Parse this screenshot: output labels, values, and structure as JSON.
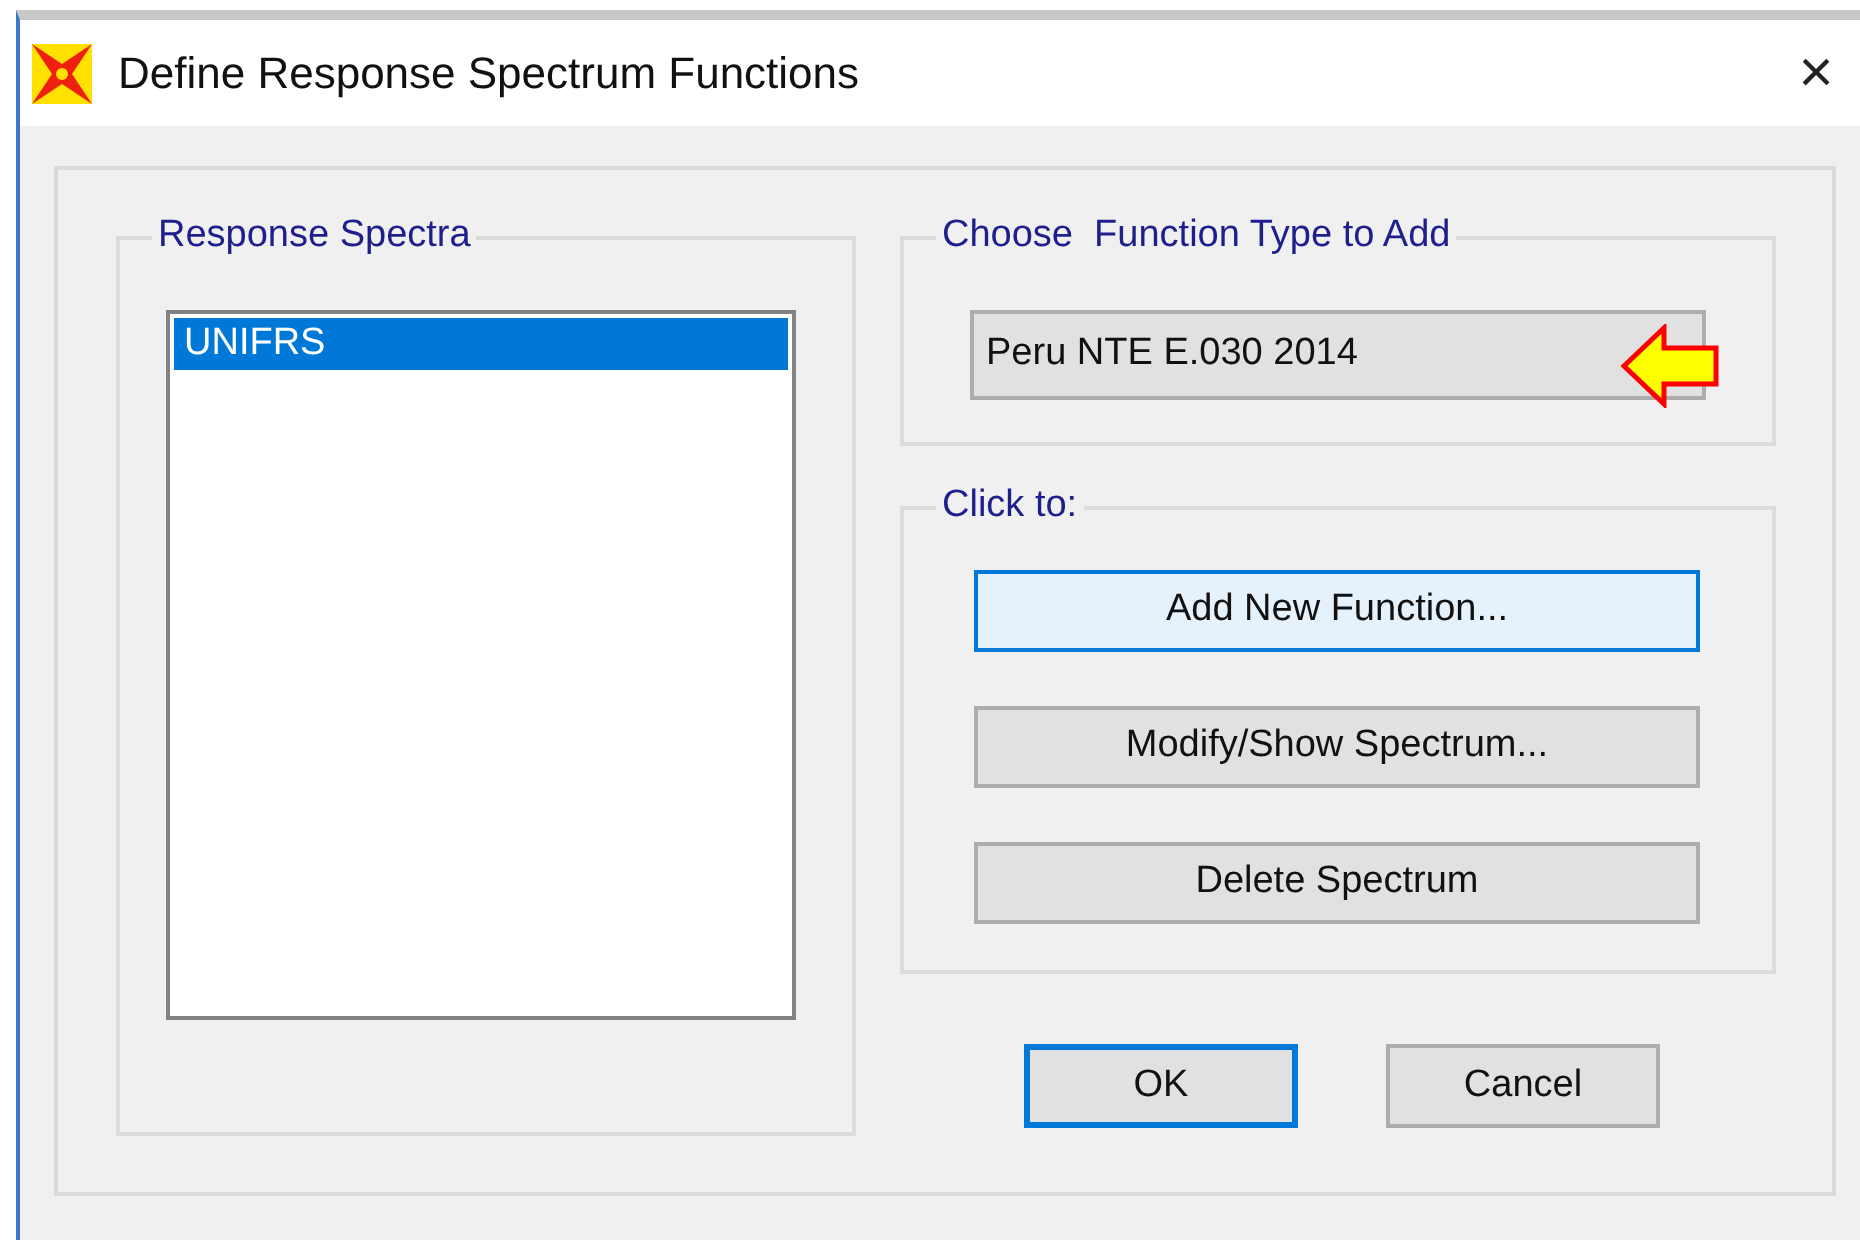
{
  "window": {
    "title": "Define Response Spectrum Functions",
    "close": "×"
  },
  "response_spectra": {
    "label": "Response Spectra",
    "items": [
      {
        "name": "UNIFRS",
        "selected": true
      }
    ]
  },
  "function_type": {
    "label": "Choose  Function Type to Add",
    "value": "Peru NTE E.030 2014"
  },
  "click_to": {
    "label": "Click to:",
    "buttons": [
      {
        "label": "Add New Function...",
        "highlighted": true
      },
      {
        "label": "Modify/Show Spectrum...",
        "highlighted": false
      },
      {
        "label": "Delete Spectrum",
        "highlighted": false
      }
    ]
  },
  "buttons": [
    {
      "label": "OK",
      "default": true
    },
    {
      "label": "Cancel",
      "default": false
    }
  ]
}
